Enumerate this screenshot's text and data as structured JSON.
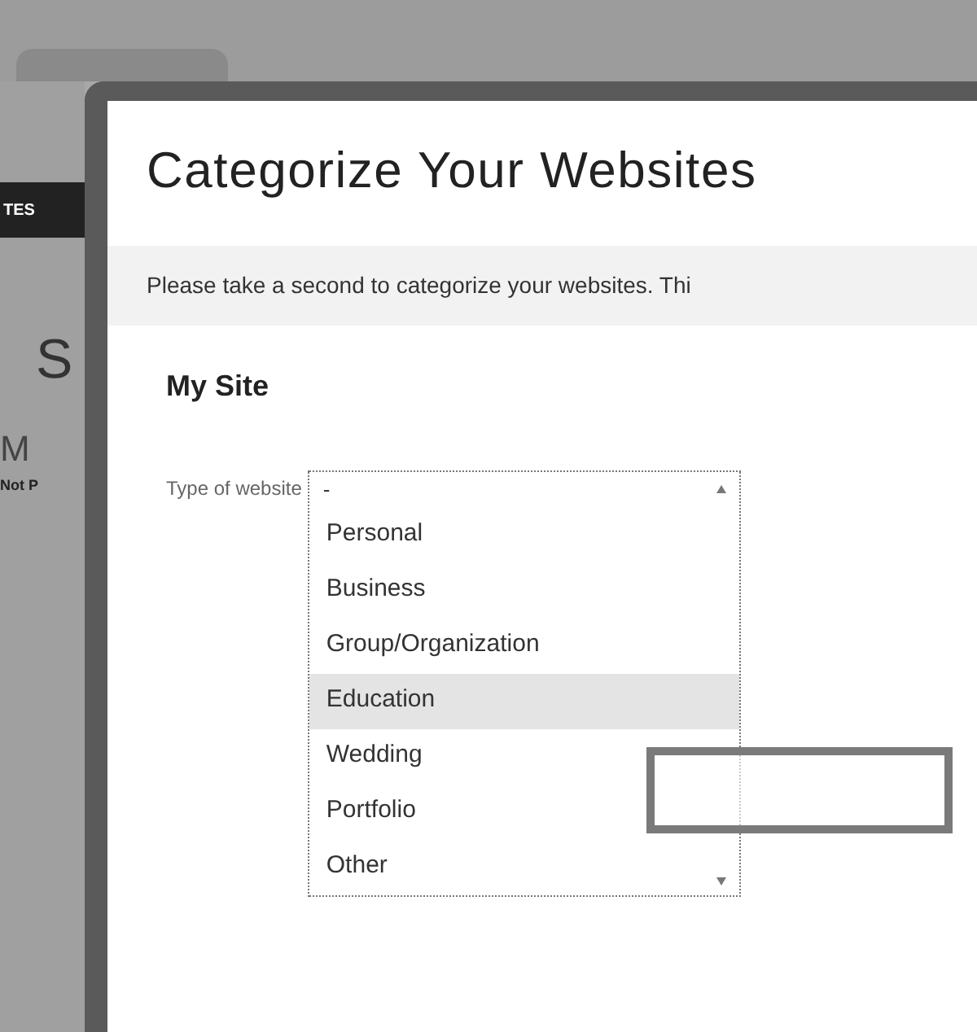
{
  "background": {
    "tab": "TES",
    "heading": "S",
    "subheading": "M",
    "note": "Not P"
  },
  "dialog": {
    "title": "Categorize Your Websites",
    "description": "Please take a second to categorize your websites. Thi",
    "site": {
      "name": "My Site",
      "field_label": "Type of website",
      "value": "-",
      "options": [
        {
          "label": "Personal",
          "selected": false
        },
        {
          "label": "Business",
          "selected": false
        },
        {
          "label": "Group/Organization",
          "selected": false
        },
        {
          "label": "Education",
          "selected": true
        },
        {
          "label": "Wedding",
          "selected": false
        },
        {
          "label": "Portfolio",
          "selected": false
        },
        {
          "label": "Other",
          "selected": false
        }
      ]
    }
  }
}
